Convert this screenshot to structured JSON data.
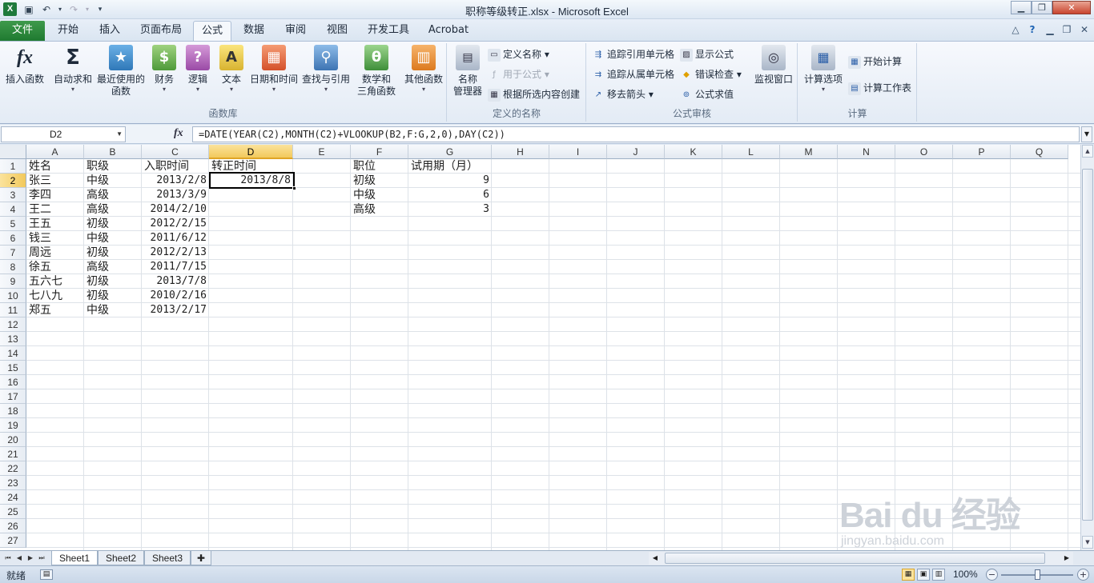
{
  "window": {
    "title": "职称等级转正.xlsx - Microsoft Excel",
    "app_icon": "X"
  },
  "tabs": [
    {
      "label": "文件"
    },
    {
      "label": "开始"
    },
    {
      "label": "插入"
    },
    {
      "label": "页面布局"
    },
    {
      "label": "公式"
    },
    {
      "label": "数据"
    },
    {
      "label": "审阅"
    },
    {
      "label": "视图"
    },
    {
      "label": "开发工具"
    },
    {
      "label": "Acrobat"
    }
  ],
  "ribbon": {
    "function_library": {
      "label": "函数库",
      "insert_function": "插入函数",
      "autosum": "自动求和",
      "recent_1": "最近使用的",
      "recent_2": "函数",
      "financial": "财务",
      "logical": "逻辑",
      "text": "文本",
      "datetime": "日期和时间",
      "lookup": "查找与引用",
      "math_1": "数学和",
      "math_2": "三角函数",
      "more": "其他函数"
    },
    "defined_names": {
      "label": "定义的名称",
      "manager_1": "名称",
      "manager_2": "管理器",
      "define_name": "定义名称",
      "use_in_formula": "用于公式",
      "create_from_selection": "根据所选内容创建"
    },
    "formula_auditing": {
      "label": "公式审核",
      "trace_precedents": "追踪引用单元格",
      "trace_dependents": "追踪从属单元格",
      "remove_arrows": "移去箭头",
      "show_formulas": "显示公式",
      "error_checking": "错误检查",
      "evaluate_formula": "公式求值",
      "watch_window": "监视窗口"
    },
    "calculation": {
      "label": "计算",
      "options": "计算选项",
      "calc_now": "开始计算",
      "calc_sheet": "计算工作表"
    },
    "icons": {
      "fx": "fx",
      "sigma": "Σ",
      "star": "★",
      "book": "$",
      "question": "?",
      "letter": "A",
      "calendar": "▦",
      "magnifier": "⚲",
      "theta": "θ",
      "books": "▥"
    }
  },
  "formula_bar": {
    "name_box": "D2",
    "fx_label": "fx",
    "formula": "=DATE(YEAR(C2),MONTH(C2)+VLOOKUP(B2,F:G,2,0),DAY(C2))"
  },
  "columns": [
    "A",
    "B",
    "C",
    "D",
    "E",
    "F",
    "G",
    "H",
    "I",
    "J",
    "K",
    "L",
    "M",
    "N",
    "O",
    "P",
    "Q"
  ],
  "rows": [
    "1",
    "2",
    "3",
    "4",
    "5",
    "6",
    "7",
    "8",
    "9",
    "10",
    "11",
    "12",
    "13",
    "14",
    "15",
    "16",
    "17",
    "18",
    "19",
    "20",
    "21",
    "22",
    "23",
    "24",
    "25",
    "26",
    "27"
  ],
  "sheet": {
    "headers": {
      "A": "姓名",
      "B": "职级",
      "C": "入职时间",
      "D": "转正时间",
      "F": "职位",
      "G": "试用期（月）"
    },
    "data": [
      {
        "name": "张三",
        "level": "中级",
        "date": "2013/2/8",
        "result": "2013/8/8"
      },
      {
        "name": "李四",
        "level": "高级",
        "date": "2013/3/9"
      },
      {
        "name": "王二",
        "level": "高级",
        "date": "2014/2/10"
      },
      {
        "name": "王五",
        "level": "初级",
        "date": "2012/2/15"
      },
      {
        "name": "钱三",
        "level": "中级",
        "date": "2011/6/12"
      },
      {
        "name": "周远",
        "level": "初级",
        "date": "2012/2/13"
      },
      {
        "name": "徐五",
        "level": "高级",
        "date": "2011/7/15"
      },
      {
        "name": "五六七",
        "level": "初级",
        "date": "2013/7/8"
      },
      {
        "name": "七八九",
        "level": "初级",
        "date": "2010/2/16"
      },
      {
        "name": "郑五",
        "level": "中级",
        "date": "2013/2/17"
      }
    ],
    "lookup": [
      {
        "position": "初级",
        "months": "9"
      },
      {
        "position": "中级",
        "months": "6"
      },
      {
        "position": "高级",
        "months": "3"
      }
    ]
  },
  "sheet_tabs": [
    "Sheet1",
    "Sheet2",
    "Sheet3"
  ],
  "status": {
    "ready": "就绪",
    "zoom": "100%"
  },
  "watermark": {
    "brand": "Bai du 经验",
    "url": "jingyan.baidu.com"
  },
  "colors": {
    "file_tab": "#1f7a30",
    "selected_header": "#f2c95c",
    "ribbon_bg": "#e3ebf5"
  }
}
